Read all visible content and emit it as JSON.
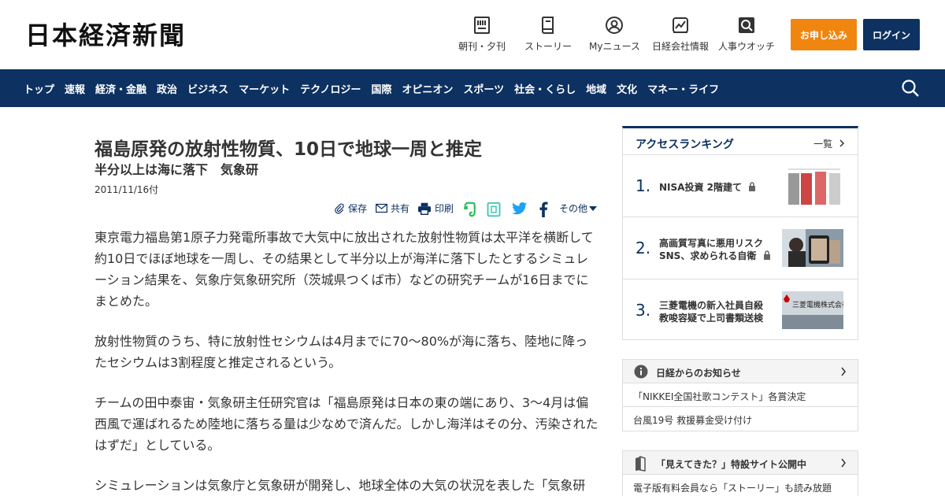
{
  "header": {
    "logo": "日本経済新聞",
    "nav": [
      {
        "label": "朝刊・夕刊",
        "icon": "newspaper-icon"
      },
      {
        "label": "ストーリー",
        "icon": "book-icon"
      },
      {
        "label": "Myニュース",
        "icon": "person-icon"
      },
      {
        "label": "日経会社情報",
        "icon": "chart-icon"
      },
      {
        "label": "人事ウオッチ",
        "icon": "search-person-icon"
      }
    ],
    "apply_label": "お申し込み",
    "login_label": "ログイン"
  },
  "categories": [
    "トップ",
    "速報",
    "経済・金融",
    "政治",
    "ビジネス",
    "マーケット",
    "テクノロジー",
    "国際",
    "オピニオン",
    "スポーツ",
    "社会・くらし",
    "地域",
    "文化",
    "マネー・ライフ"
  ],
  "article": {
    "title": "福島原発の放射性物質、10日で地球一周と推定",
    "subtitle": "半分以上は海に落下　気象研",
    "date": "2011/11/16付",
    "tools": {
      "save": "保存",
      "share": "共有",
      "print": "印刷",
      "more": "その他"
    },
    "paragraphs": [
      "東京電力福島第1原子力発電所事故で大気中に放出された放射性物質は太平洋を横断して約10日でほぼ地球を一周し、その結果として半分以上が海洋に落下したとするシミュレーション結果を、気象庁気象研究所（茨城県つくば市）などの研究チームが16日までにまとめた。",
      "放射性物質のうち、特に放射性セシウムは4月までに70～80%が海に落ち、陸地に降ったセシウムは3割程度と推定されるという。",
      "チームの田中泰宙・気象研主任研究官は「福島原発は日本の東の端にあり、3～4月は偏西風で運ばれるため陸地に落ちる量は少なめで済んだ。しかし海洋はその分、汚染されたはずだ」としている。",
      "シミュレーションは気象庁と気象研が開発し、地球全体の大気の状況を表した「気象研"
    ]
  },
  "ranking": {
    "title": "アクセスランキング",
    "all_label": "一覧",
    "items": [
      {
        "num": "1.",
        "lines": [
          "NISA投資 2階建て"
        ]
      },
      {
        "num": "2.",
        "lines": [
          "高画質写真に悪用リスク",
          "SNS、求められる自衛"
        ]
      },
      {
        "num": "3.",
        "lines": [
          "三菱電機の新入社員自殺",
          "教唆容疑で上司書類送検"
        ]
      }
    ],
    "thumb3_text": "三菱電機株式会社"
  },
  "notices": {
    "title": "日経からのお知らせ",
    "rows": [
      "「NIKKEI全国社歌コンテスト」各賞決定",
      "台風19号 救援募金受け付け"
    ]
  },
  "special": {
    "title": "「見えてきた？」特設サイト公開中",
    "rows": [
      "電子版有料会員なら「ストーリー」も読み放題"
    ]
  },
  "colors": {
    "navy": "#0d3161",
    "orange": "#f0850f"
  }
}
